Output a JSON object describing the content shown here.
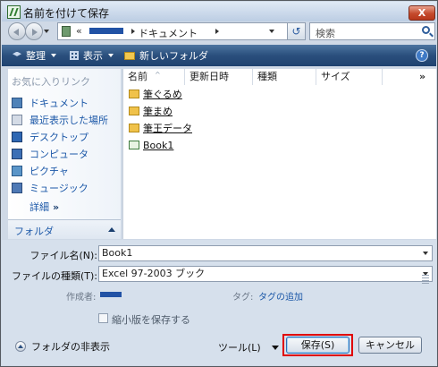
{
  "window": {
    "title": "名前を付けて保存",
    "close_label": "X"
  },
  "address": {
    "leading_chevron": "«",
    "folder_label": "ドキュメント",
    "refresh_label": "↺"
  },
  "search": {
    "placeholder": "検索"
  },
  "toolbar": {
    "organize": "整理",
    "views": "表示",
    "new_folder": "新しいフォルダ",
    "help": "?"
  },
  "sidebar": {
    "header": "お気に入りリンク",
    "items": [
      {
        "label": "ドキュメント",
        "icon": "documents-icon"
      },
      {
        "label": "最近表示した場所",
        "icon": "recent-places-icon"
      },
      {
        "label": "デスクトップ",
        "icon": "desktop-icon"
      },
      {
        "label": "コンピュータ",
        "icon": "computer-icon"
      },
      {
        "label": "ピクチャ",
        "icon": "pictures-icon"
      },
      {
        "label": "ミュージック",
        "icon": "music-icon"
      }
    ],
    "more_label": "詳細",
    "more_arrow": "»",
    "folders_label": "フォルダ"
  },
  "file_list": {
    "columns": [
      "名前",
      "更新日時",
      "種類",
      "サイズ"
    ],
    "more": "»",
    "sort_arrow": "^",
    "files": [
      {
        "name": "筆ぐるめ",
        "type": "folder"
      },
      {
        "name": "筆まめ",
        "type": "folder"
      },
      {
        "name": "筆王データ",
        "type": "folder"
      },
      {
        "name": "Book1",
        "type": "excel"
      }
    ]
  },
  "form": {
    "file_name_label": "ファイル名(N):",
    "file_name_value": "Book1",
    "file_type_label": "ファイルの種類(T):",
    "file_type_value": "Excel 97-2003 ブック",
    "author_label": "作成者:",
    "tag_label": "タグ:",
    "tag_link": "タグの追加",
    "thumbnail_label": "縮小版を保存する",
    "thumbnail_checked": false
  },
  "footer": {
    "hide_folders": "フォルダの非表示",
    "tools": "ツール(L)",
    "save": "保存(S)",
    "cancel": "キャンセル"
  },
  "colors": {
    "highlight": "#e00000",
    "toolbar": "#2a4f7d",
    "link": "#1c58a8"
  }
}
